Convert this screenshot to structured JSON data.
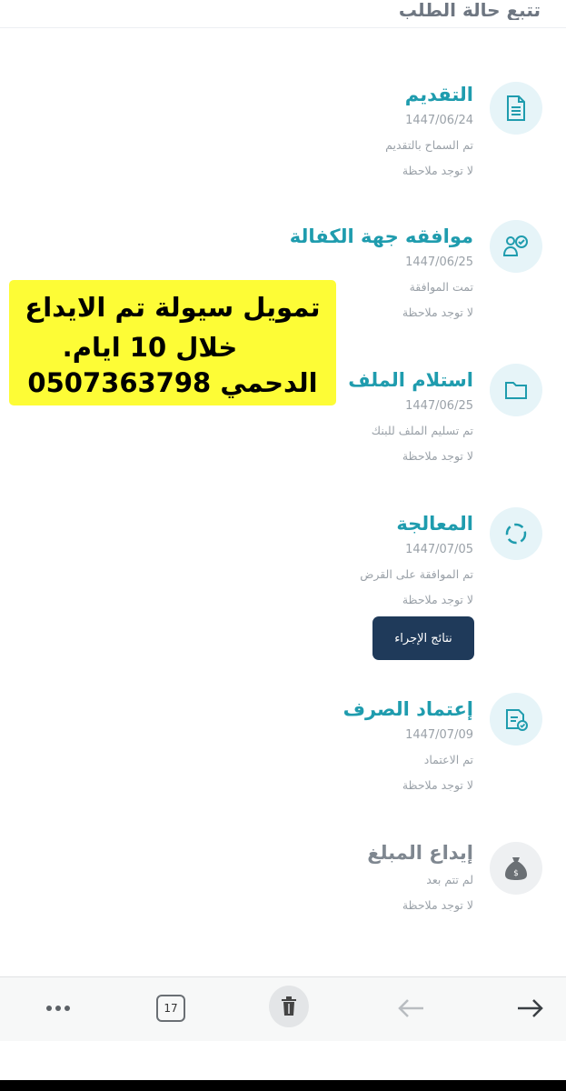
{
  "header": {
    "title": "تتبع حالة الطلب"
  },
  "steps": [
    {
      "title": "التقديم",
      "date": "1447/06/24",
      "desc": "تم السماح بالتقديم",
      "note": "لا توجد ملاحظة",
      "icon": "document-icon"
    },
    {
      "title": "موافقه جهة الكفالة",
      "date": "1447/06/25",
      "desc": "تمت الموافقة",
      "note": "لا توجد ملاحظة",
      "icon": "people-approve-icon"
    },
    {
      "title": "استلام الملف",
      "date": "1447/06/25",
      "desc": "تم تسليم الملف للبنك",
      "note": "لا توجد ملاحظة",
      "icon": "folder-icon"
    },
    {
      "title": "المعالجة",
      "date": "1447/07/05",
      "desc": "تم الموافقة على القرض",
      "note": "لا توجد ملاحظة",
      "icon": "processing-icon"
    },
    {
      "title": "إعتماد الصرف",
      "date": "1447/07/09",
      "desc": "تم الاعتماد",
      "note": "لا توجد ملاحظة",
      "icon": "approval-document-icon"
    },
    {
      "title": "إيداع المبلغ",
      "desc": "لم تتم بعد",
      "note": "لا توجد ملاحظة",
      "icon": "money-bag-icon"
    }
  ],
  "action_button": {
    "label": "نتائج الإجراء"
  },
  "promo": {
    "line1": "تمويل سيولة تم الايداع",
    "line2": "خلال 10 ايام.",
    "line3": "الدحمي 0507363798"
  },
  "browser_bar": {
    "tab_count": "17"
  },
  "colors": {
    "accent": "#1f9cae",
    "button": "#1f3a5a",
    "highlight": "#fdfc36"
  }
}
